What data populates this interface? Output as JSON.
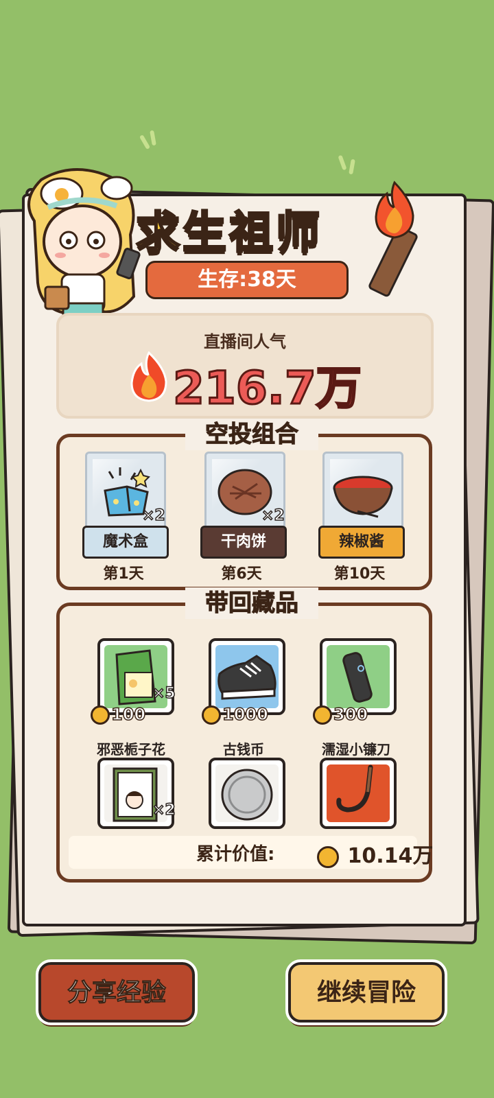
{
  "header": {
    "title": "求生祖师",
    "survival": "生存:38天"
  },
  "popularity": {
    "label": "直播间人气",
    "value": "216.7万"
  },
  "airdrop": {
    "title": "空投组合",
    "items": [
      {
        "name": "魔术盒",
        "qty": "×2",
        "day": "第1天",
        "tag_color": "#cfe1ec"
      },
      {
        "name": "干肉饼",
        "qty": "×2",
        "day": "第6天",
        "tag_color": "#5a3b33"
      },
      {
        "name": "辣椒酱",
        "qty": "",
        "day": "第10天",
        "tag_color": "#f0a935"
      }
    ]
  },
  "collection": {
    "title": "带回藏品",
    "items": [
      {
        "name": "",
        "qty": "×5",
        "price": "100",
        "card_color": "#8fcf86"
      },
      {
        "name": "",
        "qty": "",
        "price": "1000",
        "card_color": "#8ec6ec"
      },
      {
        "name": "",
        "qty": "",
        "price": "300",
        "card_color": "#8fcf86"
      },
      {
        "name": "邪恶栀子花",
        "qty": "×2",
        "price": "",
        "card_color": "#f4f2ee"
      },
      {
        "name": "古钱币",
        "qty": "",
        "price": "",
        "card_color": "#f4f2ee"
      },
      {
        "name": "濡湿小镰刀",
        "qty": "",
        "price": "",
        "card_color": "#e0542b"
      }
    ],
    "total_label": "累计价值:",
    "total_value": "10.14万"
  },
  "buttons": {
    "share": "分享经验",
    "continue": "继续冒险"
  }
}
